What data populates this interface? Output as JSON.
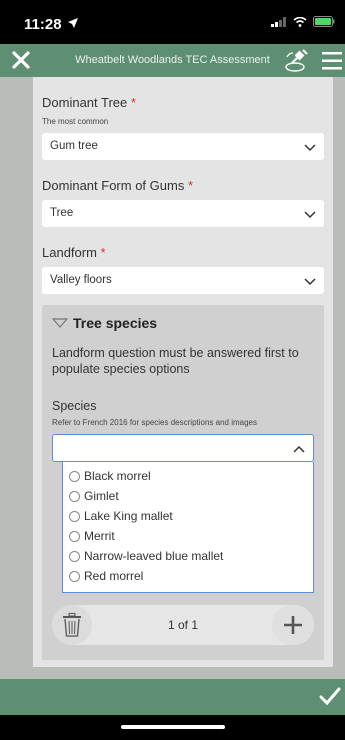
{
  "status": {
    "time": "11:28",
    "icons": [
      "location-arrow-icon",
      "signal-icon",
      "wifi-icon",
      "battery-icon"
    ]
  },
  "header": {
    "title": "Wheatbelt Woodlands TEC Assessment",
    "icons": [
      "close-icon",
      "gps-icon",
      "menu-icon"
    ]
  },
  "form": {
    "dominant_tree": {
      "label": "Dominant Tree",
      "required": "*",
      "sublabel": "The most common",
      "value": "Gum tree"
    },
    "dominant_form": {
      "label": "Dominant Form of Gums",
      "required": "*",
      "value": "Tree"
    },
    "landform": {
      "label": "Landform",
      "required": "*",
      "value": "Valley floors"
    }
  },
  "tree_species": {
    "title": "Tree species",
    "note": "Landform question must be answered first to populate species options",
    "species_label": "Species",
    "species_sub": "Refer to French 2016 for species descriptions and images",
    "selected": "",
    "options": [
      "Black morrel",
      "Gimlet",
      "Lake King mallet",
      "Merrit",
      "Narrow-leaved blue mallet",
      "Red morrel"
    ],
    "pager": "1 of 1"
  },
  "colors": {
    "header_green": "#5f8f73",
    "required_red": "#cc3333",
    "focus_blue": "#5b8fd6"
  }
}
